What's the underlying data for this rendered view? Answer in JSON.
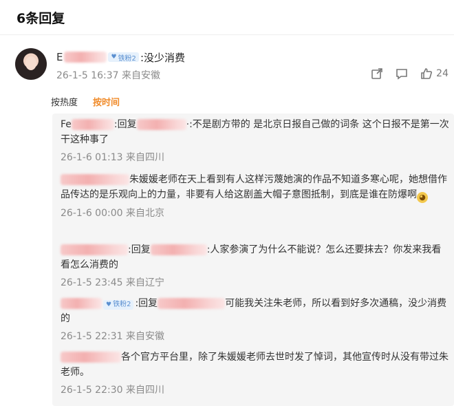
{
  "header": {
    "title": "6条回复"
  },
  "main_comment": {
    "user_initial": "E",
    "badge": "铁粉2",
    "text": ":没少消费",
    "timestamp": "26-1-5 16:37",
    "location": "来自安徽",
    "like_count": "24"
  },
  "sort": {
    "hot": "按热度",
    "time": "按时间"
  },
  "replies": [
    {
      "prefix": "Fe",
      "reply_to": ":回复",
      "text": "·:不是剧方带的 是北京日报自己做的词条 这个日报不是第一次干这种事了",
      "timestamp": "26-1-6 01:13",
      "location": "来自四川"
    },
    {
      "text": "朱媛媛老师在天上看到有人这样污蔑她演的作品不知道多寒心呢，她想借作品传达的是乐观向上的力量，非要有人给这剧盖大帽子意图抵制，到底是谁在防爆啊",
      "timestamp": "26-1-6 00:00",
      "location": "来自北京"
    },
    {
      "reply_to": ":回复",
      "text": ":人家参演了为什么不能说？怎么还要抹去？你发来我看看怎么消费的",
      "timestamp": "26-1-5 23:45",
      "location": "来自辽宁"
    },
    {
      "badge": "铁粉2",
      "reply_to": ":回复",
      "text": "可能我关注朱老师，所以看到好多次通稿，没少消费的",
      "timestamp": "26-1-5 22:31",
      "location": "来自安徽"
    },
    {
      "text": "各个官方平台里，除了朱媛媛老师去世时发了悼词，其他宣传时从没有带过朱老师。",
      "timestamp": "26-1-5 22:30",
      "location": "来自四川"
    }
  ],
  "icons": {
    "share": "share-icon",
    "comment": "comment-icon",
    "like": "like-icon",
    "emoji": "smile-emoji"
  }
}
